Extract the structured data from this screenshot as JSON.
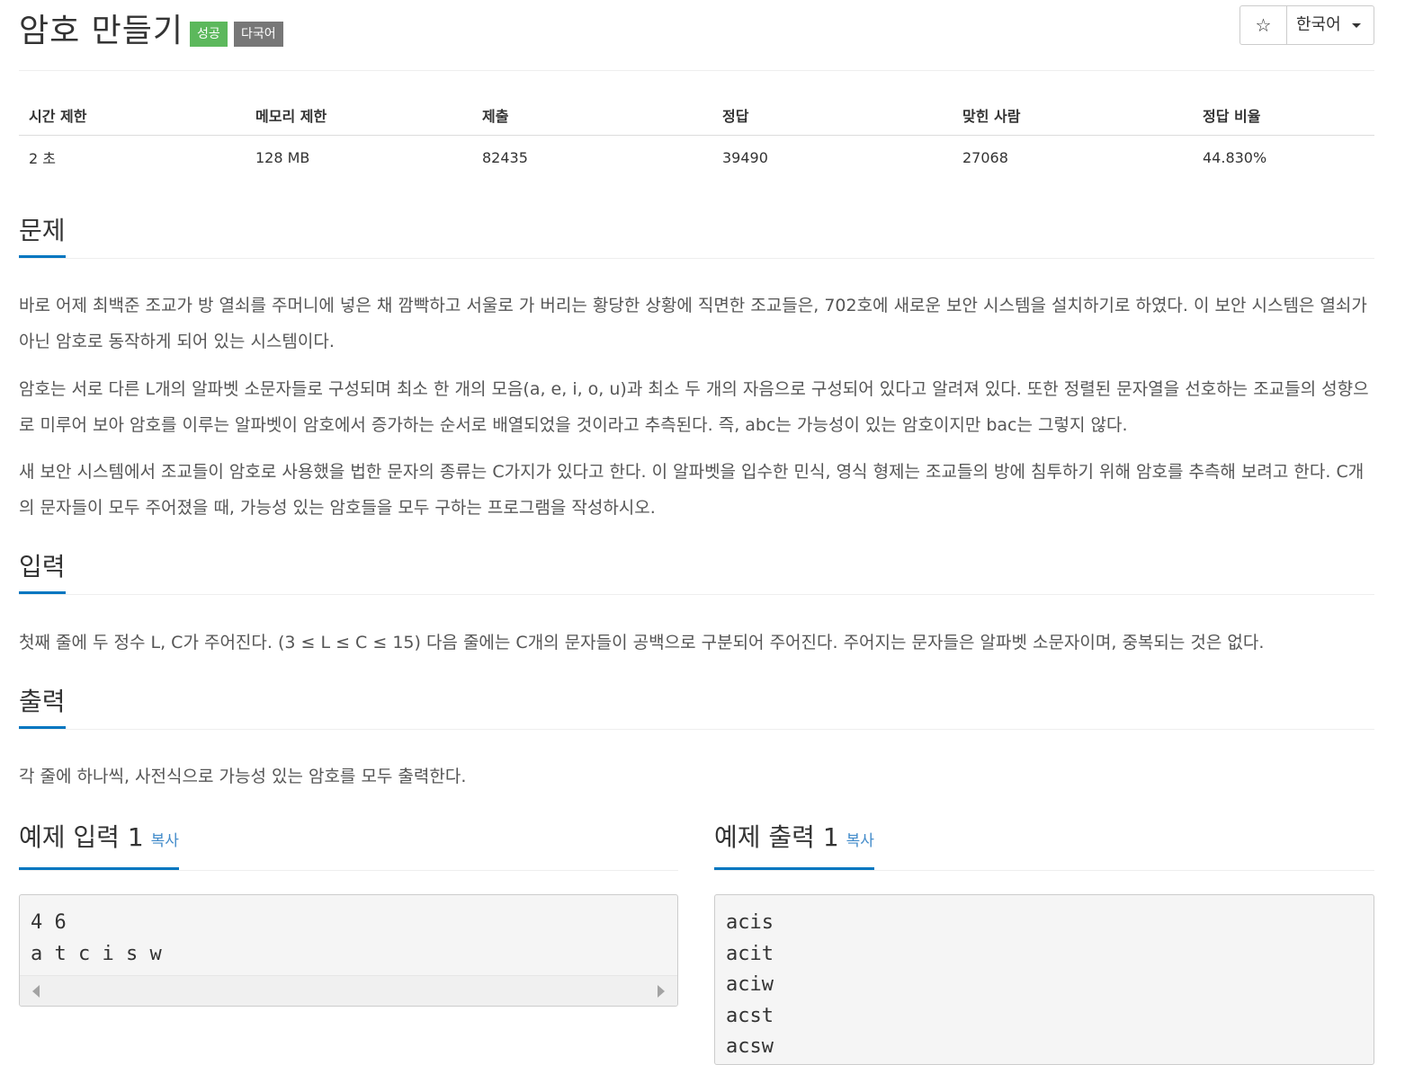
{
  "problem": {
    "title": "암호 만들기",
    "badges": {
      "success": "성공",
      "multilang": "다국어"
    },
    "star_icon": "☆",
    "language": "한국어"
  },
  "info": {
    "headers": [
      "시간 제한",
      "메모리 제한",
      "제출",
      "정답",
      "맞힌 사람",
      "정답 비율"
    ],
    "values": [
      "2 초",
      "128 MB",
      "82435",
      "39490",
      "27068",
      "44.830%"
    ]
  },
  "sections": {
    "problem_title": "문제",
    "problem_paragraphs": [
      "바로 어제 최백준 조교가 방 열쇠를 주머니에 넣은 채 깜빡하고 서울로 가 버리는 황당한 상황에 직면한 조교들은, 702호에 새로운 보안 시스템을 설치하기로 하였다. 이 보안 시스템은 열쇠가 아닌 암호로 동작하게 되어 있는 시스템이다.",
      "암호는 서로 다른 L개의 알파벳 소문자들로 구성되며 최소 한 개의 모음(a, e, i, o, u)과 최소 두 개의 자음으로 구성되어 있다고 알려져 있다. 또한 정렬된 문자열을 선호하는 조교들의 성향으로 미루어 보아 암호를 이루는 알파벳이 암호에서 증가하는 순서로 배열되었을 것이라고 추측된다. 즉, abc는 가능성이 있는 암호이지만 bac는 그렇지 않다.",
      "새 보안 시스템에서 조교들이 암호로 사용했을 법한 문자의 종류는 C가지가 있다고 한다. 이 알파벳을 입수한 민식, 영식 형제는 조교들의 방에 침투하기 위해 암호를 추측해 보려고 한다. C개의 문자들이 모두 주어졌을 때, 가능성 있는 암호들을 모두 구하는 프로그램을 작성하시오."
    ],
    "input_title": "입력",
    "input_text": "첫째 줄에 두 정수 L, C가 주어진다. (3 ≤ L ≤ C ≤ 15) 다음 줄에는 C개의 문자들이 공백으로 구분되어 주어진다. 주어지는 문자들은 알파벳 소문자이며, 중복되는 것은 없다.",
    "output_title": "출력",
    "output_text": "각 줄에 하나씩, 사전식으로 가능성 있는 암호를 모두 출력한다."
  },
  "samples": {
    "input_title": "예제 입력 1",
    "output_title": "예제 출력 1",
    "copy_label": "복사",
    "input_text": "4 6\na t c i s w",
    "output_text": "acis\nacit\naciw\nacst\nacsw"
  },
  "colors": {
    "accent": "#0076c0",
    "success": "#5cb85c",
    "gray_badge": "#777777",
    "link": "#428bca"
  }
}
